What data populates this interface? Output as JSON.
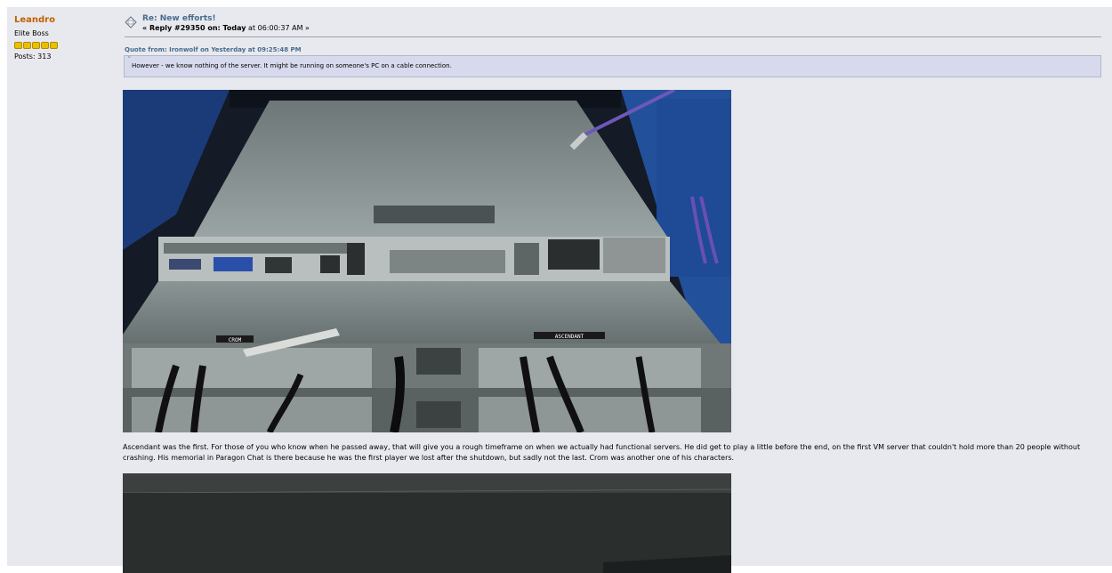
{
  "poster": {
    "name": "Leandro",
    "rank": "Elite Boss",
    "stars": 5,
    "posts": "Posts: 313"
  },
  "post": {
    "icon": "message-diamond-icon",
    "title": "Re: New efforts!",
    "reply_prefix": "« Reply #29350 on: Today",
    "time_suffix": "at 06:00:37 AM »"
  },
  "quote": {
    "header": "Quote from: Ironwolf on Yesterday at 09:25:48 PM",
    "text": "However - we know nothing of the server. It might be running on someone's PC on a cable connection."
  },
  "body": {
    "paragraph": "Ascendant was the first. For those of you who know when he passed away, that will give you a rough timeframe on when we actually had functional servers. He did get to play a little before the end, on the first VM server that couldn't hold more than 20 people without crashing. His memorial in Paragon Chat is there because he was the first player we lost after the shutdown, but sadly not the last. Crom was another one of his characters."
  },
  "images": {
    "first": {
      "label_crom": "CROM",
      "label_ascendant": "ASCENDANT"
    }
  },
  "colors": {
    "poster_name": "#c06002",
    "link_blue": "#476c8e",
    "post_bg": "#e8e9ee",
    "quote_bg": "#d7daec"
  }
}
